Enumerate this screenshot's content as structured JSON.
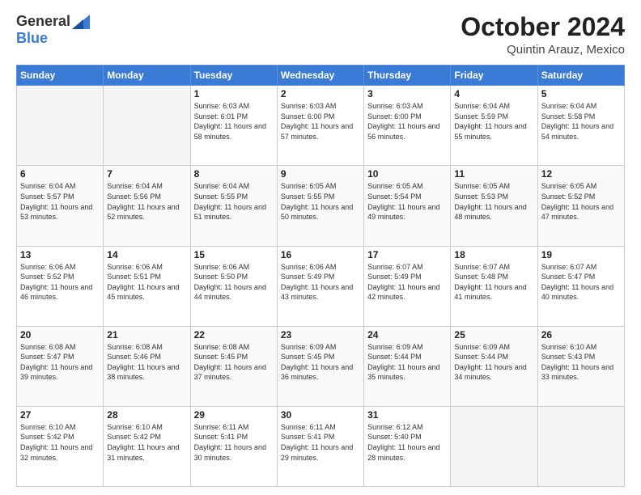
{
  "header": {
    "logo_general": "General",
    "logo_blue": "Blue",
    "month_title": "October 2024",
    "location": "Quintin Arauz, Mexico"
  },
  "weekdays": [
    "Sunday",
    "Monday",
    "Tuesday",
    "Wednesday",
    "Thursday",
    "Friday",
    "Saturday"
  ],
  "weeks": [
    [
      {
        "day": "",
        "empty": true
      },
      {
        "day": "",
        "empty": true
      },
      {
        "day": "1",
        "sunrise": "6:03 AM",
        "sunset": "6:01 PM",
        "daylight": "11 hours and 58 minutes."
      },
      {
        "day": "2",
        "sunrise": "6:03 AM",
        "sunset": "6:00 PM",
        "daylight": "11 hours and 57 minutes."
      },
      {
        "day": "3",
        "sunrise": "6:03 AM",
        "sunset": "6:00 PM",
        "daylight": "11 hours and 56 minutes."
      },
      {
        "day": "4",
        "sunrise": "6:04 AM",
        "sunset": "5:59 PM",
        "daylight": "11 hours and 55 minutes."
      },
      {
        "day": "5",
        "sunrise": "6:04 AM",
        "sunset": "5:58 PM",
        "daylight": "11 hours and 54 minutes."
      }
    ],
    [
      {
        "day": "6",
        "sunrise": "6:04 AM",
        "sunset": "5:57 PM",
        "daylight": "11 hours and 53 minutes."
      },
      {
        "day": "7",
        "sunrise": "6:04 AM",
        "sunset": "5:56 PM",
        "daylight": "11 hours and 52 minutes."
      },
      {
        "day": "8",
        "sunrise": "6:04 AM",
        "sunset": "5:55 PM",
        "daylight": "11 hours and 51 minutes."
      },
      {
        "day": "9",
        "sunrise": "6:05 AM",
        "sunset": "5:55 PM",
        "daylight": "11 hours and 50 minutes."
      },
      {
        "day": "10",
        "sunrise": "6:05 AM",
        "sunset": "5:54 PM",
        "daylight": "11 hours and 49 minutes."
      },
      {
        "day": "11",
        "sunrise": "6:05 AM",
        "sunset": "5:53 PM",
        "daylight": "11 hours and 48 minutes."
      },
      {
        "day": "12",
        "sunrise": "6:05 AM",
        "sunset": "5:52 PM",
        "daylight": "11 hours and 47 minutes."
      }
    ],
    [
      {
        "day": "13",
        "sunrise": "6:06 AM",
        "sunset": "5:52 PM",
        "daylight": "11 hours and 46 minutes."
      },
      {
        "day": "14",
        "sunrise": "6:06 AM",
        "sunset": "5:51 PM",
        "daylight": "11 hours and 45 minutes."
      },
      {
        "day": "15",
        "sunrise": "6:06 AM",
        "sunset": "5:50 PM",
        "daylight": "11 hours and 44 minutes."
      },
      {
        "day": "16",
        "sunrise": "6:06 AM",
        "sunset": "5:49 PM",
        "daylight": "11 hours and 43 minutes."
      },
      {
        "day": "17",
        "sunrise": "6:07 AM",
        "sunset": "5:49 PM",
        "daylight": "11 hours and 42 minutes."
      },
      {
        "day": "18",
        "sunrise": "6:07 AM",
        "sunset": "5:48 PM",
        "daylight": "11 hours and 41 minutes."
      },
      {
        "day": "19",
        "sunrise": "6:07 AM",
        "sunset": "5:47 PM",
        "daylight": "11 hours and 40 minutes."
      }
    ],
    [
      {
        "day": "20",
        "sunrise": "6:08 AM",
        "sunset": "5:47 PM",
        "daylight": "11 hours and 39 minutes."
      },
      {
        "day": "21",
        "sunrise": "6:08 AM",
        "sunset": "5:46 PM",
        "daylight": "11 hours and 38 minutes."
      },
      {
        "day": "22",
        "sunrise": "6:08 AM",
        "sunset": "5:45 PM",
        "daylight": "11 hours and 37 minutes."
      },
      {
        "day": "23",
        "sunrise": "6:09 AM",
        "sunset": "5:45 PM",
        "daylight": "11 hours and 36 minutes."
      },
      {
        "day": "24",
        "sunrise": "6:09 AM",
        "sunset": "5:44 PM",
        "daylight": "11 hours and 35 minutes."
      },
      {
        "day": "25",
        "sunrise": "6:09 AM",
        "sunset": "5:44 PM",
        "daylight": "11 hours and 34 minutes."
      },
      {
        "day": "26",
        "sunrise": "6:10 AM",
        "sunset": "5:43 PM",
        "daylight": "11 hours and 33 minutes."
      }
    ],
    [
      {
        "day": "27",
        "sunrise": "6:10 AM",
        "sunset": "5:42 PM",
        "daylight": "11 hours and 32 minutes."
      },
      {
        "day": "28",
        "sunrise": "6:10 AM",
        "sunset": "5:42 PM",
        "daylight": "11 hours and 31 minutes."
      },
      {
        "day": "29",
        "sunrise": "6:11 AM",
        "sunset": "5:41 PM",
        "daylight": "11 hours and 30 minutes."
      },
      {
        "day": "30",
        "sunrise": "6:11 AM",
        "sunset": "5:41 PM",
        "daylight": "11 hours and 29 minutes."
      },
      {
        "day": "31",
        "sunrise": "6:12 AM",
        "sunset": "5:40 PM",
        "daylight": "11 hours and 28 minutes."
      },
      {
        "day": "",
        "empty": true
      },
      {
        "day": "",
        "empty": true
      }
    ]
  ],
  "labels": {
    "sunrise": "Sunrise:",
    "sunset": "Sunset:",
    "daylight": "Daylight: "
  }
}
